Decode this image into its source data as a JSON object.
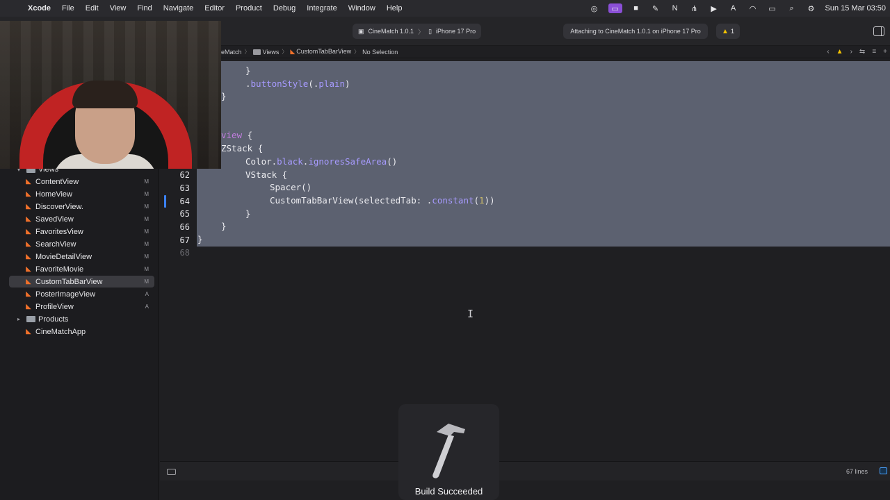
{
  "menubar": {
    "app_name": "Xcode",
    "menus": [
      "File",
      "Edit",
      "View",
      "Find",
      "Navigate",
      "Editor",
      "Product",
      "Debug",
      "Integrate",
      "Window",
      "Help"
    ],
    "clock": "Sun 15 Mar  03:50",
    "status_icons": [
      "sync-icon",
      "screen-record-icon",
      "facetime-icon",
      "pen-icon",
      "notion-icon",
      "antenna-icon",
      "play-icon",
      "text-input-icon",
      "wifi-icon",
      "battery-icon",
      "search-icon",
      "control-center-icon"
    ]
  },
  "toolbar": {
    "scheme": "CineMatch 1.0.1",
    "destination": "iPhone 17 Pro",
    "status": "Attaching to CineMatch 1.0.1 on iPhone 17 Pro",
    "warning_count": "1",
    "accent_color": "#f5c400"
  },
  "jumpbar": {
    "crumbs": [
      "eMatch",
      "Views",
      "CustomTabBarView",
      "No Selection"
    ]
  },
  "navigator": {
    "group_views": "Views",
    "items": [
      {
        "name": "ContentView",
        "badge": "M"
      },
      {
        "name": "HomeView",
        "badge": "M"
      },
      {
        "name": "DiscoverView.",
        "badge": "M"
      },
      {
        "name": "SavedView",
        "badge": "M"
      },
      {
        "name": "FavoritesView",
        "badge": "M"
      },
      {
        "name": "SearchView",
        "badge": "M"
      },
      {
        "name": "MovieDetailView",
        "badge": "M"
      },
      {
        "name": "FavoriteMovie",
        "badge": "M"
      },
      {
        "name": "CustomTabBarView",
        "badge": "M"
      },
      {
        "name": "PosterImageView",
        "badge": "A"
      },
      {
        "name": "ProfileView",
        "badge": "A"
      }
    ],
    "group_products": "Products",
    "app_file": "CineMatchApp"
  },
  "editor": {
    "line_numbers": [
      "62",
      "63",
      "64",
      "65",
      "66",
      "67",
      "68"
    ],
    "code": {
      "l1_close": "}",
      "l2_dot": ".",
      "l2_fn": "buttonStyle",
      "l2_open": "(.",
      "l2_kw": "plain",
      "l2_close": ")",
      "l3_close": "}",
      "l4_kw": "view",
      "l4_rest": " {",
      "l5_text": "ZStack {",
      "l6_a": "Color.",
      "l6_kw": "black",
      "l6_dot": ".",
      "l6_fn": "ignoresSafeArea",
      "l6_end": "()",
      "l7_text": "VStack {",
      "l8_text": "Spacer()",
      "l9_a": "CustomTabBarView(selectedTab: .",
      "l9_fn": "constant",
      "l9_open": "(",
      "l9_num": "1",
      "l9_end": "))",
      "l10_close": "}",
      "l11_close": "}",
      "l12_close": "}"
    }
  },
  "bottom_bar": {
    "line_count": "67 lines"
  },
  "hud": {
    "label": "Build Succeeded"
  }
}
